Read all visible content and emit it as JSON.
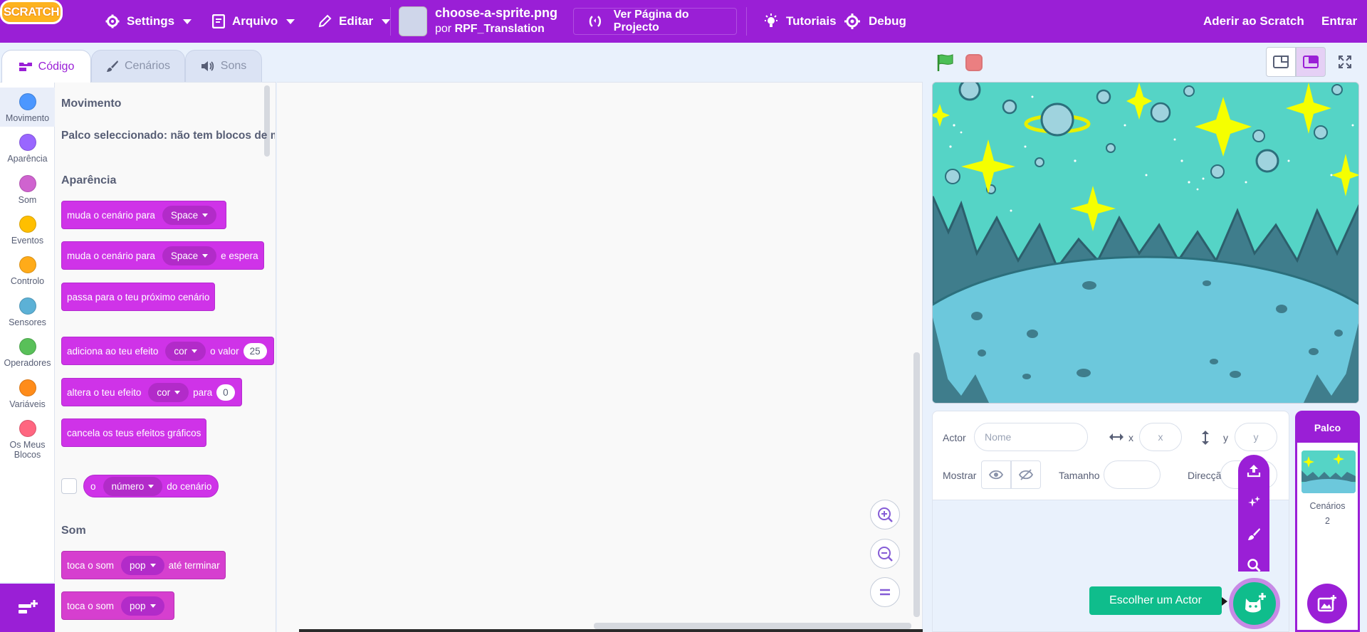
{
  "menu": {
    "logo": "SCRATCH",
    "settings": "Settings",
    "file": "Arquivo",
    "edit": "Editar",
    "project_title": "choose-a-sprite.png",
    "author_prefix": "por",
    "author": "RPF_Translation",
    "see_project_page": "Ver Página do Projecto",
    "tutorials": "Tutoriais",
    "debug": "Debug",
    "join": "Aderir ao Scratch",
    "sign_in": "Entrar"
  },
  "tabs": [
    {
      "label": "Código",
      "icon": "code-icon",
      "active": true
    },
    {
      "label": "Cenários",
      "icon": "brush-icon",
      "active": false
    },
    {
      "label": "Sons",
      "icon": "speaker-icon",
      "active": false
    }
  ],
  "categories": [
    {
      "label": "Movimento",
      "color": "#4c97ff"
    },
    {
      "label": "Aparência",
      "color": "#9966ff"
    },
    {
      "label": "Som",
      "color": "#cf63cf"
    },
    {
      "label": "Eventos",
      "color": "#ffbf00"
    },
    {
      "label": "Controlo",
      "color": "#ffab19"
    },
    {
      "label": "Sensores",
      "color": "#5cb1d6"
    },
    {
      "label": "Operadores",
      "color": "#59c059"
    },
    {
      "label": "Variáveis",
      "color": "#ff8c1a"
    },
    {
      "label": "Os Meus Blocos",
      "color": "#ff6680"
    }
  ],
  "palette": {
    "motion_heading": "Movimento",
    "motion_note": "Palco seleccionado: não tem blocos de movimento",
    "looks_heading": "Aparência",
    "sound_heading": "Som",
    "looks_blocks": {
      "b1_text": "muda o cenário para",
      "b1_dd": "Space",
      "b2_text": "muda o cenário para",
      "b2_dd": "Space",
      "b2_tail": "e espera",
      "b3_text": "passa para o teu próximo cenário",
      "b4_text": "adiciona ao teu efeito",
      "b4_dd": "cor",
      "b4_mid": "o valor",
      "b4_num": "25",
      "b5_text": "altera o teu efeito",
      "b5_dd": "cor",
      "b5_mid": "para",
      "b5_num": "0",
      "b6_text": "cancela os teus efeitos gráficos",
      "r1_pre": "o",
      "r1_dd": "número",
      "r1_tail": "do cenário"
    },
    "sound_blocks": {
      "s1_text": "toca o som",
      "s1_dd": "pop",
      "s1_tail": "até terminar",
      "s2_text": "toca o som",
      "s2_dd": "pop"
    }
  },
  "sprite_info": {
    "sprite_label": "Actor",
    "name_placeholder": "Nome",
    "x_label": "x",
    "x_placeholder": "x",
    "y_label": "y",
    "y_placeholder": "y",
    "show_label": "Mostrar",
    "size_label": "Tamanho",
    "direction_label": "Direcção"
  },
  "stage_pane": {
    "title": "Palco",
    "backdrops_label": "Cenários",
    "backdrops_count": "2"
  },
  "sprite_add": {
    "tooltip": "Escolher um Actor"
  },
  "colors": {
    "menu_bar": "#9a1fd6",
    "looks_block": "#cf33e8",
    "sound_block": "#d63fcf",
    "add_sprite": "#0fbd8c"
  }
}
